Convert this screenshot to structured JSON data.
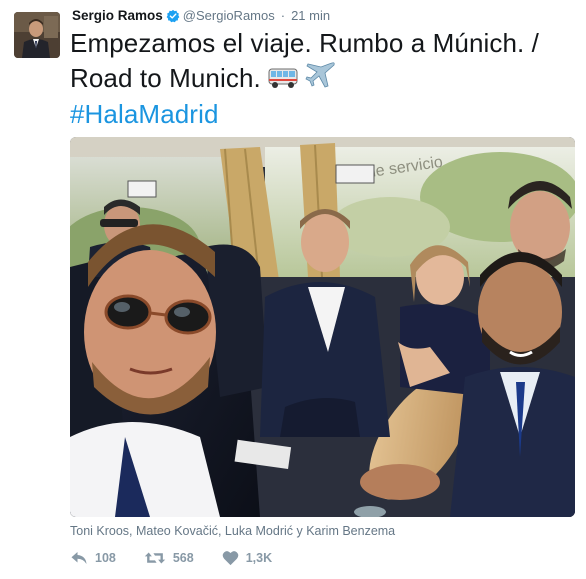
{
  "tweet": {
    "author_name": "Sergio Ramos",
    "handle": "@SergioRamos",
    "separator": "·",
    "time": "21 min",
    "text": "Empezamos el viaje. Rumbo a Múnich. / Road to Munich.",
    "emojis": [
      "bus-icon",
      "airplane-icon"
    ],
    "hashtag": "#HalaMadrid",
    "photo_caption": "Toni Kroos, Mateo Kovačić, Luka Modrić y Karim Benzema",
    "photo_subject": "selfie-on-bus"
  },
  "actions": {
    "reply_count": "108",
    "retweet_count": "568",
    "like_count": "1,3K"
  },
  "colors": {
    "text": "#14171a",
    "muted": "#657786",
    "action": "#8899a6",
    "link": "#1b95e0",
    "verified": "#1da1f2"
  }
}
